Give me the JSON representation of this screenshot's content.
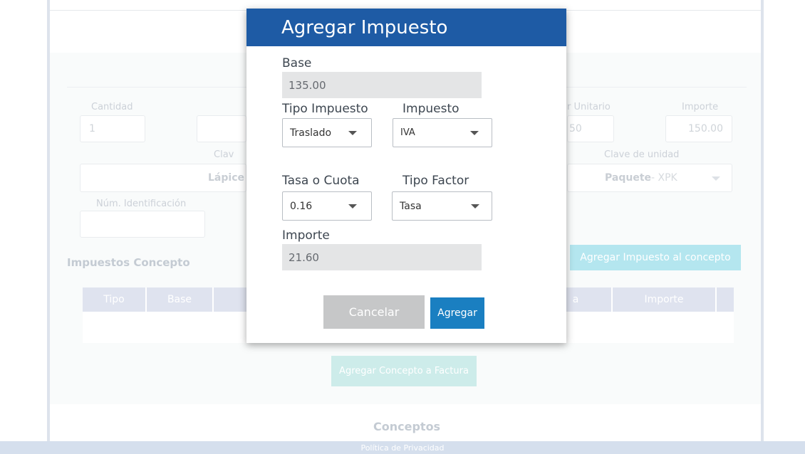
{
  "background": {
    "labels": {
      "cantidad": "Cantidad",
      "valor_unitario": "r Unitario",
      "importe": "Importe",
      "clave_prod": "Clav",
      "clave_unidad": "Clave de unidad",
      "num_identificacion": "Núm. Identificación"
    },
    "values": {
      "cantidad": "1",
      "valor_unitario": "50",
      "importe": "150.00",
      "producto": "Lápice",
      "unidad_bold": "Paquete",
      "unidad_rest": " - XPK"
    },
    "impuestos_concepto_title": "Impuestos Concepto",
    "agregar_impuesto_concepto_button": "Agregar Impuesto al concepto",
    "table_headers": {
      "tipo": "Tipo",
      "base": "Base",
      "tasa_partial": "a",
      "importe": "Importe"
    },
    "agregar_concepto_factura_button": "Agregar Concepto a Factura",
    "conceptos_title": "Conceptos",
    "footer_link": "Política de Privacidad"
  },
  "modal": {
    "title": "Agregar Impuesto",
    "base_label": "Base",
    "base_value": "135.00",
    "tipo_impuesto_label": "Tipo Impuesto",
    "tipo_impuesto_value": "Traslado",
    "impuesto_label": "Impuesto",
    "impuesto_value": "IVA",
    "tasa_cuota_label": "Tasa o Cuota",
    "tasa_cuota_value": "0.16",
    "tipo_factor_label": "Tipo Factor",
    "tipo_factor_value": "Tasa",
    "importe_label": "Importe",
    "importe_value": "21.60",
    "cancel_label": "Cancelar",
    "add_label": "Agregar"
  },
  "colors": {
    "modal_header": "#1e5ba5",
    "primary_button": "#1a7fc1",
    "cancel_button": "#c6c7c8",
    "teal_button": "#b4e6ef"
  },
  "icons": {
    "dropdown": "caret-down-icon"
  }
}
